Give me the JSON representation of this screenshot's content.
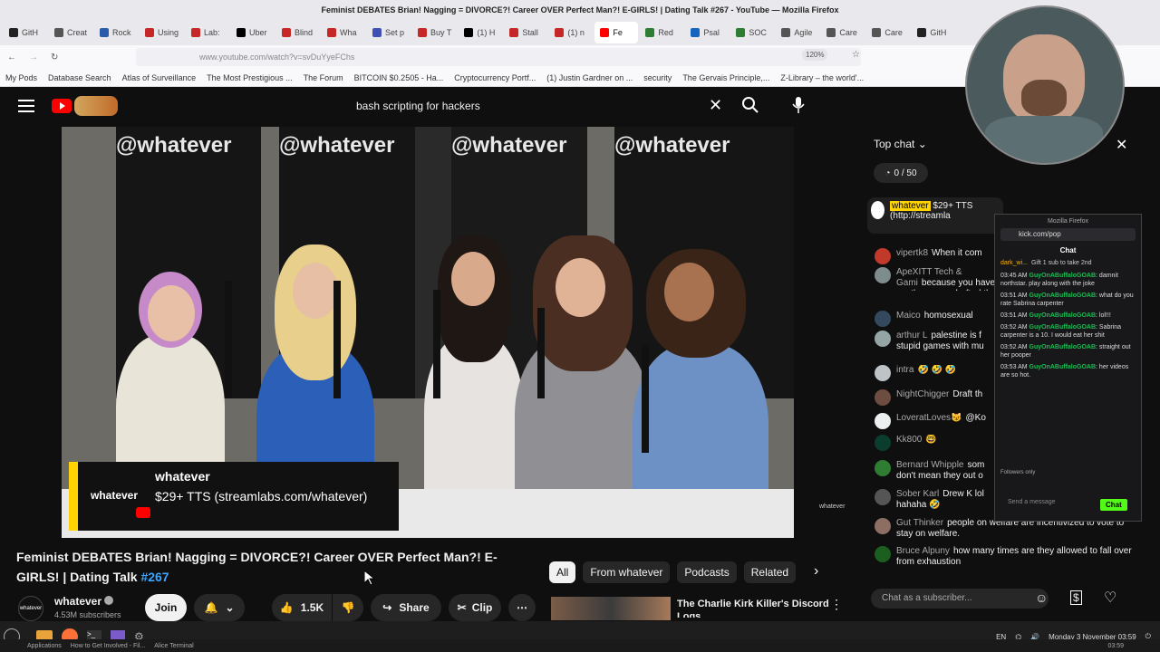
{
  "browser": {
    "window_title": "Feminist DEBATES Brian! Nagging = DIVORCE?! Career OVER Perfect Man?! E-GIRLS! | Dating Talk #267 - YouTube — Mozilla Firefox",
    "tabs": [
      {
        "label": "GitH",
        "color": "#222222"
      },
      {
        "label": "Creat",
        "color": "#555555"
      },
      {
        "label": "Rock",
        "color": "#2b5cab"
      },
      {
        "label": "Using",
        "color": "#c62828"
      },
      {
        "label": "Lab:",
        "color": "#c62828"
      },
      {
        "label": "Uber",
        "color": "#000000"
      },
      {
        "label": "Blind",
        "color": "#c62828"
      },
      {
        "label": "Wha",
        "color": "#c62828"
      },
      {
        "label": "Set p",
        "color": "#3f51b5"
      },
      {
        "label": "Buy T",
        "color": "#c62828"
      },
      {
        "label": "(1) H",
        "color": "#000000"
      },
      {
        "label": "Stall",
        "color": "#c62828"
      },
      {
        "label": "(1) n",
        "color": "#c62828"
      },
      {
        "label": "Fe",
        "color": "#ff0000",
        "active": true
      },
      {
        "label": "Red",
        "color": "#2e7d32"
      },
      {
        "label": "Psal",
        "color": "#1565c0"
      },
      {
        "label": "SOC",
        "color": "#2e7d32"
      },
      {
        "label": "Agile",
        "color": "#555555"
      },
      {
        "label": "Care",
        "color": "#555555"
      },
      {
        "label": "Care",
        "color": "#555555"
      },
      {
        "label": "GitH",
        "color": "#222222"
      }
    ],
    "url": "www.youtube.com/watch?v=svDuYyeFChs",
    "zoom": "120%",
    "bookmarks": [
      "My Pods",
      "Database Search",
      "Atlas of Surveillance",
      "The Most Prestigious ...",
      "The Forum",
      "BITCOIN $0.2505 - Ha...",
      "Cryptocurrency Portf...",
      "(1) Justin Gardner on ...",
      "security",
      "The Gervais Principle,...",
      "Z-Library – the world'..."
    ]
  },
  "youtube": {
    "search_query": "bash scripting for hackers",
    "video": {
      "wall_text": "@whatever",
      "overlay_channel": "whatever",
      "overlay_logo": "whatever",
      "overlay_message": "$29+ TTS (streamlabs.com/whatever)",
      "watermark": "whatever"
    },
    "title_main": "Feminist DEBATES Brian! Nagging = DIVORCE?! Career OVER Perfect Man?! E-GIRLS! | Dating Talk ",
    "title_hashtag": "#267",
    "channel_name": "whatever",
    "subscribers": "4.53M subscribers",
    "join_label": "Join",
    "likes": "1.5K",
    "share_label": "Share",
    "clip_label": "Clip",
    "filter_tabs": [
      "All",
      "From whatever",
      "Podcasts",
      "Related"
    ],
    "rec_title": "The Charlie Kirk Killer's Discord Logs"
  },
  "chat": {
    "header": "Top chat",
    "counter": "0 / 50",
    "pinned_author": "whatever",
    "pinned_text": "$29+ TTS (http://streamla",
    "messages": [
      {
        "author": "vipertk8",
        "text": "When it com",
        "color": "#c0392b"
      },
      {
        "author": "ApeXITT Tech & Gami",
        "text": "because you have a v they were drafted that",
        "color": "#7f8c8d"
      },
      {
        "author": "Maico",
        "text": "homosexual",
        "color": "#34495e"
      },
      {
        "author": "arthur L",
        "text": "palestine is f stupid games with mu",
        "color": "#95a5a6"
      },
      {
        "author": "intra",
        "text": "🤣 🤣 🤣",
        "color": "#bdc3c7"
      },
      {
        "author": "NightChigger",
        "text": "Draft th",
        "color": "#6d4c41"
      },
      {
        "author": "LoveratLoves😼",
        "text": "@Ko",
        "color": "#ecf0f1"
      },
      {
        "author": "Kk800",
        "text": "🤓",
        "color": "#0b3d2e"
      },
      {
        "author": "Bernard Whipple",
        "text": "som don't mean they out o",
        "color": "#2e7d32"
      },
      {
        "author": "Sober Karl",
        "text": "Drew K lol hahaha 🤣",
        "color": "#555555"
      },
      {
        "author": "Gut Thinker",
        "text": "people on welfare are incentivized to vote to stay on welfare.",
        "color": "#8d6e63"
      },
      {
        "author": "Bruce Alpuny",
        "text": "how many times are they allowed to fall over from exhaustion",
        "color": "#1b5e20"
      }
    ],
    "input_placeholder": "Chat as a subscriber..."
  },
  "kick_popup": {
    "window_title": "Mozilla Firefox",
    "url": "kick.com/pop",
    "header": "Chat",
    "gift_user": "dark_wi...",
    "gift_text": "Gift 1 sub to take 2nd",
    "messages": [
      {
        "time": "03:45 AM",
        "user": "GuyOnABuffaloGOAB",
        "text": "damnit northstar. play along with the joke"
      },
      {
        "time": "03:51 AM",
        "user": "GuyOnABuffaloGOAB",
        "text": "what do you rate Sabrina carpenter"
      },
      {
        "time": "03:51 AM",
        "user": "GuyOnABuffaloGOAB",
        "text": "lol!!!"
      },
      {
        "time": "03:52 AM",
        "user": "GuyOnABuffaloGOAB",
        "text": "Sabrina carpenter is a 10. I would eat her shit"
      },
      {
        "time": "03:52 AM",
        "user": "GuyOnABuffaloGOAB",
        "text": "straight out her pooper"
      },
      {
        "time": "03:53 AM",
        "user": "GuyOnABuffaloGOAB",
        "text": "her videos are so hot."
      }
    ],
    "followers_only": "Followers only",
    "send_placeholder": "Send a message",
    "chat_button": "Chat"
  },
  "taskbar": {
    "lang": "EN",
    "datetime": "Monday  3 November 03:59",
    "items": [
      "Applications",
      "How to Get Involved - Fil...",
      "Alice Terminal"
    ],
    "clock2": "03:59"
  },
  "colors": {
    "youtube_red": "#ff0000",
    "kick_green": "#53fc18",
    "accent_blue": "#3ea6ff"
  }
}
